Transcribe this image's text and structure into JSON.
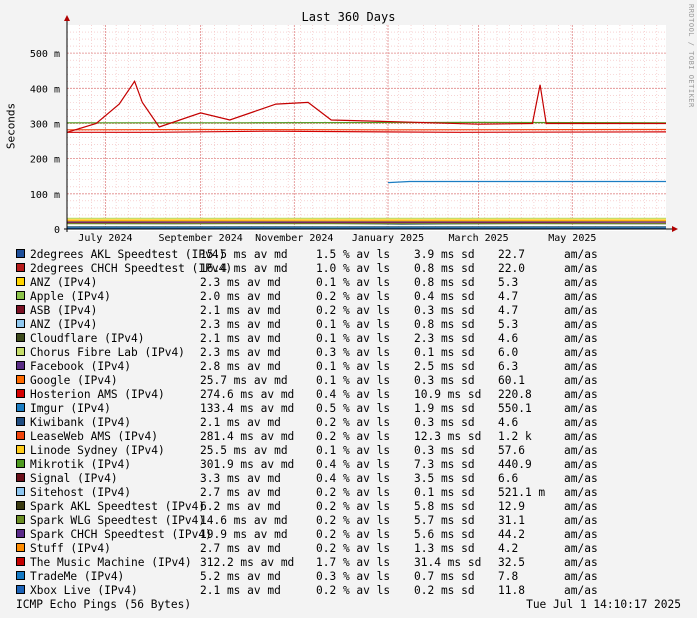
{
  "chart_data": {
    "type": "line",
    "title": "Last 360 Days",
    "ylabel": "Seconds",
    "ylim": [
      0,
      0.58
    ],
    "yticks": [
      {
        "v": 0,
        "label": "0"
      },
      {
        "v": 0.1,
        "label": "100 m"
      },
      {
        "v": 0.2,
        "label": "200 m"
      },
      {
        "v": 0.3,
        "label": "300 m"
      },
      {
        "v": 0.4,
        "label": "400 m"
      },
      {
        "v": 0.5,
        "label": "500 m"
      }
    ],
    "xlim": [
      "2024-06-06",
      "2025-07-01"
    ],
    "xticks": [
      {
        "d": "2024-07-01",
        "label": "July 2024"
      },
      {
        "d": "2024-09-01",
        "label": "September 2024"
      },
      {
        "d": "2024-11-01",
        "label": "November 2024"
      },
      {
        "d": "2025-01-01",
        "label": "January 2025"
      },
      {
        "d": "2025-03-01",
        "label": "March 2025"
      },
      {
        "d": "2025-05-01",
        "label": "May 2025"
      }
    ],
    "grid": true,
    "legend_position": "below",
    "series": [
      {
        "name": "2degrees AKL Speedtest (IPv4)",
        "color": "#1e4f9a",
        "avg": "15.5 ms av md",
        "loss": "1.5 % av ls",
        "sd": "3.9 ms sd",
        "max": "22.7",
        "unit": "am/as",
        "points": [
          [
            "2024-06-06",
            0.016
          ],
          [
            "2024-08-15",
            0.015
          ],
          [
            "2024-11-01",
            0.017
          ],
          [
            "2025-01-10",
            0.014
          ],
          [
            "2025-04-01",
            0.016
          ],
          [
            "2025-07-01",
            0.015
          ]
        ]
      },
      {
        "name": "2degrees CHCH Speedtest (IPv4)",
        "color": "#b71c1c",
        "avg": "16.4 ms av md",
        "loss": "1.0 % av ls",
        "sd": "0.8 ms sd",
        "max": "22.0",
        "unit": "am/as",
        "points": [
          [
            "2024-06-06",
            0.017
          ],
          [
            "2024-10-01",
            0.016
          ],
          [
            "2025-02-01",
            0.018
          ],
          [
            "2025-07-01",
            0.016
          ]
        ]
      },
      {
        "name": "ANZ (IPv4)",
        "color": "#ffd400",
        "avg": "2.3 ms av md",
        "loss": "0.1 % av ls",
        "sd": "0.8 ms sd",
        "max": "5.3",
        "unit": "am/as",
        "points": [
          [
            "2024-06-06",
            0.023
          ],
          [
            "2024-12-01",
            0.022
          ],
          [
            "2025-07-01",
            0.023
          ]
        ]
      },
      {
        "name": "Apple (IPv4)",
        "color": "#8bc34a",
        "avg": "2.0 ms av md",
        "loss": "0.2 % av ls",
        "sd": "0.4 ms sd",
        "max": "4.7",
        "unit": "am/as",
        "points": [
          [
            "2024-06-06",
            0.002
          ],
          [
            "2025-07-01",
            0.002
          ]
        ]
      },
      {
        "name": "ASB (IPv4)",
        "color": "#7b1023",
        "avg": "2.1 ms av md",
        "loss": "0.2 % av ls",
        "sd": "0.3 ms sd",
        "max": "4.7",
        "unit": "am/as",
        "points": [
          [
            "2024-06-06",
            0.002
          ],
          [
            "2025-07-01",
            0.002
          ]
        ]
      },
      {
        "name": "ANZ (IPv4)",
        "color": "#90c8f0",
        "avg": "2.3 ms av md",
        "loss": "0.1 % av ls",
        "sd": "0.8 ms sd",
        "max": "5.3",
        "unit": "am/as",
        "points": [
          [
            "2024-06-06",
            0.003
          ],
          [
            "2025-07-01",
            0.003
          ]
        ]
      },
      {
        "name": "Cloudflare (IPv4)",
        "color": "#3d4a1b",
        "avg": "2.1 ms av md",
        "loss": "0.1 % av ls",
        "sd": "2.3 ms sd",
        "max": "4.6",
        "unit": "am/as",
        "points": [
          [
            "2024-06-06",
            0.002
          ],
          [
            "2025-07-01",
            0.002
          ]
        ]
      },
      {
        "name": "Chorus Fibre Lab (IPv4)",
        "color": "#c6dd6a",
        "avg": "2.3 ms av md",
        "loss": "0.3 % av ls",
        "sd": "0.1 ms sd",
        "max": "6.0",
        "unit": "am/as",
        "points": [
          [
            "2024-06-06",
            0.03
          ],
          [
            "2025-07-01",
            0.03
          ]
        ]
      },
      {
        "name": "Facebook (IPv4)",
        "color": "#5a2d86",
        "avg": "2.8 ms av md",
        "loss": "0.1 % av ls",
        "sd": "2.5 ms sd",
        "max": "6.3",
        "unit": "am/as",
        "points": [
          [
            "2024-06-06",
            0.003
          ],
          [
            "2025-07-01",
            0.003
          ]
        ]
      },
      {
        "name": "Google (IPv4)",
        "color": "#ff6a00",
        "avg": "25.7 ms av md",
        "loss": "0.1 % av ls",
        "sd": "0.3 ms sd",
        "max": "60.1",
        "unit": "am/as",
        "points": [
          [
            "2024-06-06",
            0.025
          ],
          [
            "2025-07-01",
            0.025
          ]
        ]
      },
      {
        "name": "Hosterion AMS (IPv4)",
        "color": "#d40000",
        "avg": "274.6 ms av md",
        "loss": "0.4 % av ls",
        "sd": "10.9 ms sd",
        "max": "220.8",
        "unit": "am/as",
        "points": [
          [
            "2024-06-06",
            0.275
          ],
          [
            "2024-08-01",
            0.275
          ],
          [
            "2024-10-15",
            0.278
          ],
          [
            "2025-02-15",
            0.275
          ],
          [
            "2025-07-01",
            0.276
          ]
        ]
      },
      {
        "name": "Imgur (IPv4)",
        "color": "#1c7dc2",
        "avg": "133.4 ms av md",
        "loss": "0.5 % av ls",
        "sd": "1.9 ms sd",
        "max": "550.1",
        "unit": "am/as",
        "points": [
          [
            "2025-01-01",
            0.132
          ],
          [
            "2025-01-15",
            0.135
          ],
          [
            "2025-07-01",
            0.135
          ]
        ]
      },
      {
        "name": "Kiwibank (IPv4)",
        "color": "#204c80",
        "avg": "2.1 ms av md",
        "loss": "0.2 % av ls",
        "sd": "0.3 ms sd",
        "max": "4.6",
        "unit": "am/as",
        "points": [
          [
            "2024-06-06",
            0.002
          ],
          [
            "2025-07-01",
            0.002
          ]
        ]
      },
      {
        "name": "LeaseWeb AMS (IPv4)",
        "color": "#f0440c",
        "avg": "281.4 ms av md",
        "loss": "0.2 % av ls",
        "sd": "12.3 ms sd",
        "max": "1.2 k",
        "unit": "am/as",
        "points": [
          [
            "2024-06-06",
            0.282
          ],
          [
            "2024-09-01",
            0.283
          ],
          [
            "2025-01-01",
            0.282
          ],
          [
            "2025-07-01",
            0.283
          ]
        ]
      },
      {
        "name": "Linode Sydney (IPv4)",
        "color": "#ffcc1a",
        "avg": "25.5 ms av md",
        "loss": "0.1 % av ls",
        "sd": "0.3 ms sd",
        "max": "57.6",
        "unit": "am/as",
        "points": [
          [
            "2024-06-06",
            0.026
          ],
          [
            "2025-07-01",
            0.026
          ]
        ]
      },
      {
        "name": "Mikrotik (IPv4)",
        "color": "#4d9a1f",
        "avg": "301.9 ms av md",
        "loss": "0.4 % av ls",
        "sd": "7.3 ms sd",
        "max": "440.9",
        "unit": "am/as",
        "points": [
          [
            "2024-06-06",
            0.302
          ],
          [
            "2024-10-01",
            0.302
          ],
          [
            "2025-03-01",
            0.303
          ],
          [
            "2025-07-01",
            0.302
          ]
        ]
      },
      {
        "name": "Signal (IPv4)",
        "color": "#6b0f1a",
        "avg": "3.3 ms av md",
        "loss": "0.4 % av ls",
        "sd": "3.5 ms sd",
        "max": "6.6",
        "unit": "am/as",
        "points": [
          [
            "2024-06-06",
            0.003
          ],
          [
            "2025-07-01",
            0.003
          ]
        ]
      },
      {
        "name": "Sitehost (IPv4)",
        "color": "#8ec6f0",
        "avg": "2.7 ms av md",
        "loss": "0.2 % av ls",
        "sd": "0.1 ms sd",
        "max": "521.1 m",
        "unit": "am/as",
        "points": [
          [
            "2024-06-06",
            0.004
          ],
          [
            "2025-07-01",
            0.004
          ]
        ]
      },
      {
        "name": "Spark AKL Speedtest (IPv4)",
        "color": "#3a3a10",
        "avg": "6.2 ms av md",
        "loss": "0.2 % av ls",
        "sd": "5.8 ms sd",
        "max": "12.9",
        "unit": "am/as",
        "points": [
          [
            "2024-06-06",
            0.006
          ],
          [
            "2025-07-01",
            0.006
          ]
        ]
      },
      {
        "name": "Spark WLG Speedtest (IPv4)",
        "color": "#6b8e23",
        "avg": "14.6 ms av md",
        "loss": "0.2 % av ls",
        "sd": "5.7 ms sd",
        "max": "31.1",
        "unit": "am/as",
        "points": [
          [
            "2024-06-06",
            0.015
          ],
          [
            "2025-07-01",
            0.015
          ]
        ]
      },
      {
        "name": "Spark CHCH Speedtest (IPv4)",
        "color": "#5a2a8a",
        "avg": "19.9 ms av md",
        "loss": "0.2 % av ls",
        "sd": "5.6 ms sd",
        "max": "44.2",
        "unit": "am/as",
        "points": [
          [
            "2024-06-06",
            0.02
          ],
          [
            "2025-07-01",
            0.02
          ]
        ]
      },
      {
        "name": "Stuff (IPv4)",
        "color": "#ff8c00",
        "avg": "2.7 ms av md",
        "loss": "0.2 % av ls",
        "sd": "1.3 ms sd",
        "max": "4.2",
        "unit": "am/as",
        "points": [
          [
            "2024-06-06",
            0.003
          ],
          [
            "2025-07-01",
            0.003
          ]
        ]
      },
      {
        "name": "The Music Machine (IPv4)",
        "color": "#c40000",
        "avg": "312.2 ms av md",
        "loss": "1.7 % av ls",
        "sd": "31.4 ms sd",
        "max": "32.5",
        "unit": "am/as",
        "points": [
          [
            "2024-06-06",
            0.275
          ],
          [
            "2024-06-25",
            0.3
          ],
          [
            "2024-07-10",
            0.355
          ],
          [
            "2024-07-20",
            0.42
          ],
          [
            "2024-07-25",
            0.36
          ],
          [
            "2024-08-05",
            0.29
          ],
          [
            "2024-09-01",
            0.33
          ],
          [
            "2024-09-20",
            0.31
          ],
          [
            "2024-10-20",
            0.355
          ],
          [
            "2024-11-10",
            0.36
          ],
          [
            "2024-11-25",
            0.31
          ],
          [
            "2025-01-05",
            0.305
          ],
          [
            "2025-03-01",
            0.298
          ],
          [
            "2025-04-05",
            0.3
          ],
          [
            "2025-04-10",
            0.41
          ],
          [
            "2025-04-14",
            0.3
          ],
          [
            "2025-07-01",
            0.3
          ]
        ]
      },
      {
        "name": "TradeMe (IPv4)",
        "color": "#1479c4",
        "avg": "5.2 ms av md",
        "loss": "0.3 % av ls",
        "sd": "0.7 ms sd",
        "max": "7.8",
        "unit": "am/as",
        "points": [
          [
            "2024-06-06",
            0.005
          ],
          [
            "2025-07-01",
            0.005
          ]
        ]
      },
      {
        "name": "Xbox Live (IPv4)",
        "color": "#1c63b8",
        "avg": "2.1 ms av md",
        "loss": "0.2 % av ls",
        "sd": "0.2 ms sd",
        "max": "11.8",
        "unit": "am/as",
        "points": [
          [
            "2024-06-06",
            0.002
          ],
          [
            "2025-07-01",
            0.002
          ]
        ]
      }
    ]
  },
  "watermark": "RRDTOOL / TOBI OETIKER",
  "footer": {
    "left": "ICMP Echo Pings (56 Bytes)",
    "right": "Tue Jul  1 14:10:17 2025"
  }
}
